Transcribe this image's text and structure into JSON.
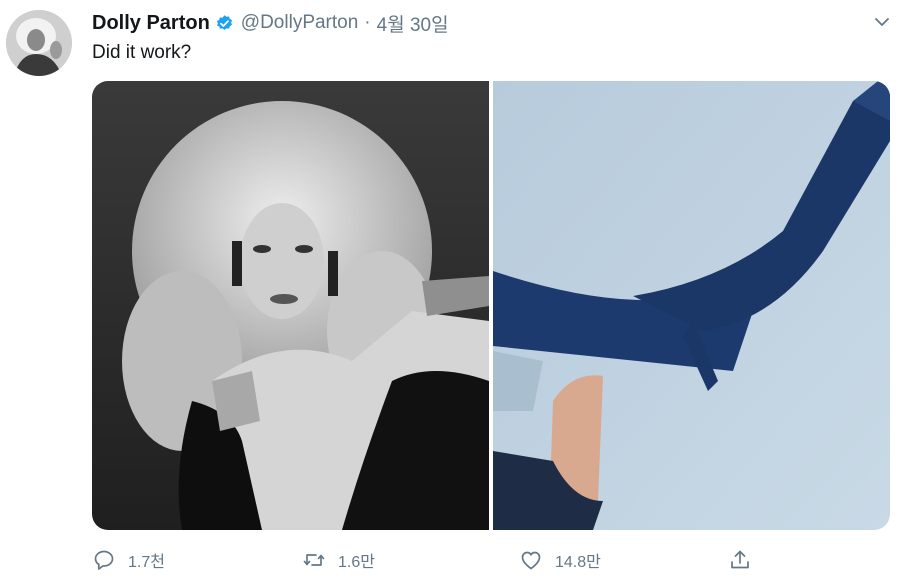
{
  "tweet": {
    "author_name": "Dolly Parton",
    "handle": "@DollyParton",
    "separator": "·",
    "date": "4월 30일",
    "text": "Did it work?",
    "actions": {
      "reply_count": "1.7천",
      "retweet_count": "1.6만",
      "like_count": "14.8만"
    }
  },
  "icons": {
    "verified": "verified-badge-icon",
    "menu": "chevron-down-icon",
    "reply": "reply-icon",
    "retweet": "retweet-icon",
    "like": "heart-icon",
    "share": "share-icon"
  },
  "colors": {
    "verified": "#1da1f2",
    "secondary_text": "#657786",
    "primary_text": "#14171a"
  }
}
